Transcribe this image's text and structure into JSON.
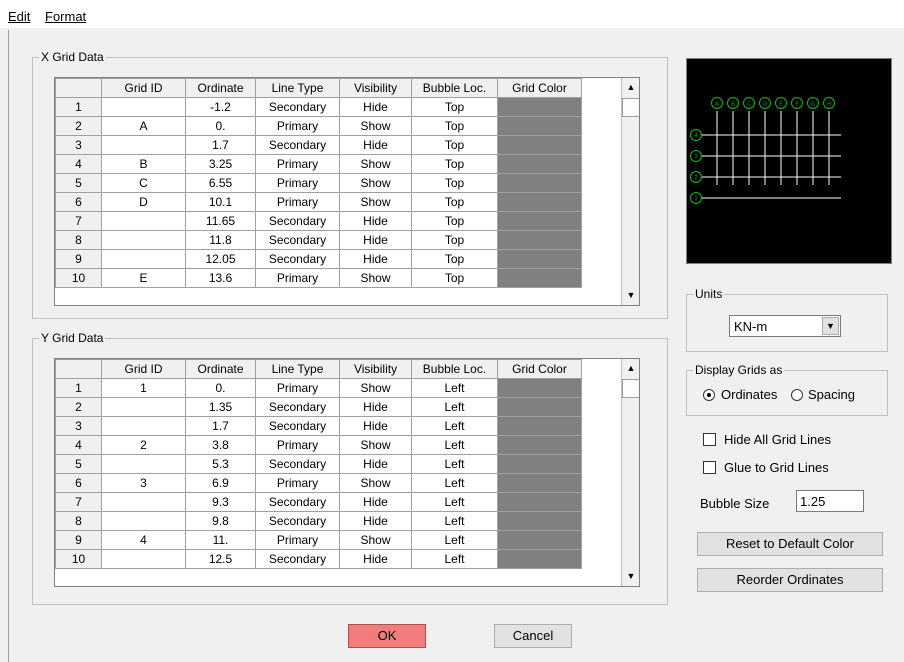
{
  "menu": {
    "edit": "Edit",
    "format": "Format"
  },
  "x_grid": {
    "title": "X Grid Data",
    "columns": [
      "",
      "Grid ID",
      "Ordinate",
      "Line Type",
      "Visibility",
      "Bubble Loc.",
      "Grid Color"
    ],
    "rows": [
      [
        "1",
        "",
        "-1.2",
        "Secondary",
        "Hide",
        "Top"
      ],
      [
        "2",
        "A",
        "0.",
        "Primary",
        "Show",
        "Top"
      ],
      [
        "3",
        "",
        "1.7",
        "Secondary",
        "Hide",
        "Top"
      ],
      [
        "4",
        "B",
        "3.25",
        "Primary",
        "Show",
        "Top"
      ],
      [
        "5",
        "C",
        "6.55",
        "Primary",
        "Show",
        "Top"
      ],
      [
        "6",
        "D",
        "10.1",
        "Primary",
        "Show",
        "Top"
      ],
      [
        "7",
        "",
        "11.65",
        "Secondary",
        "Hide",
        "Top"
      ],
      [
        "8",
        "",
        "11.8",
        "Secondary",
        "Hide",
        "Top"
      ],
      [
        "9",
        "",
        "12.05",
        "Secondary",
        "Hide",
        "Top"
      ],
      [
        "10",
        "E",
        "13.6",
        "Primary",
        "Show",
        "Top"
      ]
    ]
  },
  "y_grid": {
    "title": "Y Grid Data",
    "columns": [
      "",
      "Grid ID",
      "Ordinate",
      "Line Type",
      "Visibility",
      "Bubble Loc.",
      "Grid Color"
    ],
    "rows": [
      [
        "1",
        "1",
        "0.",
        "Primary",
        "Show",
        "Left"
      ],
      [
        "2",
        "",
        "1.35",
        "Secondary",
        "Hide",
        "Left"
      ],
      [
        "3",
        "",
        "1.7",
        "Secondary",
        "Hide",
        "Left"
      ],
      [
        "4",
        "2",
        "3.8",
        "Primary",
        "Show",
        "Left"
      ],
      [
        "5",
        "",
        "5.3",
        "Secondary",
        "Hide",
        "Left"
      ],
      [
        "6",
        "3",
        "6.9",
        "Primary",
        "Show",
        "Left"
      ],
      [
        "7",
        "",
        "9.3",
        "Secondary",
        "Hide",
        "Left"
      ],
      [
        "8",
        "",
        "9.8",
        "Secondary",
        "Hide",
        "Left"
      ],
      [
        "9",
        "4",
        "11.",
        "Primary",
        "Show",
        "Left"
      ],
      [
        "10",
        "",
        "12.5",
        "Secondary",
        "Hide",
        "Left"
      ]
    ]
  },
  "grid_color_swatch": "#808080",
  "units": {
    "title": "Units",
    "value": "KN-m"
  },
  "display": {
    "title": "Display Grids as",
    "ordinates": "Ordinates",
    "spacing": "Spacing",
    "selected": "Ordinates"
  },
  "options": {
    "hide_all": "Hide All Grid Lines",
    "glue": "Glue to Grid Lines",
    "bubble_size_label": "Bubble Size",
    "bubble_size_value": "1.25"
  },
  "buttons": {
    "reset_color": "Reset to Default Color",
    "reorder": "Reorder Ordinates",
    "ok": "OK",
    "cancel": "Cancel"
  },
  "preview_colors": {
    "background": "#000000",
    "lines": "#ffffff",
    "bubbles": "#00c000"
  },
  "preview_bubble_labels": {
    "top": [
      "A",
      "B",
      "C",
      "D",
      "E",
      "F",
      "G",
      "H"
    ],
    "left": [
      "4",
      "3",
      "2",
      "1"
    ]
  }
}
